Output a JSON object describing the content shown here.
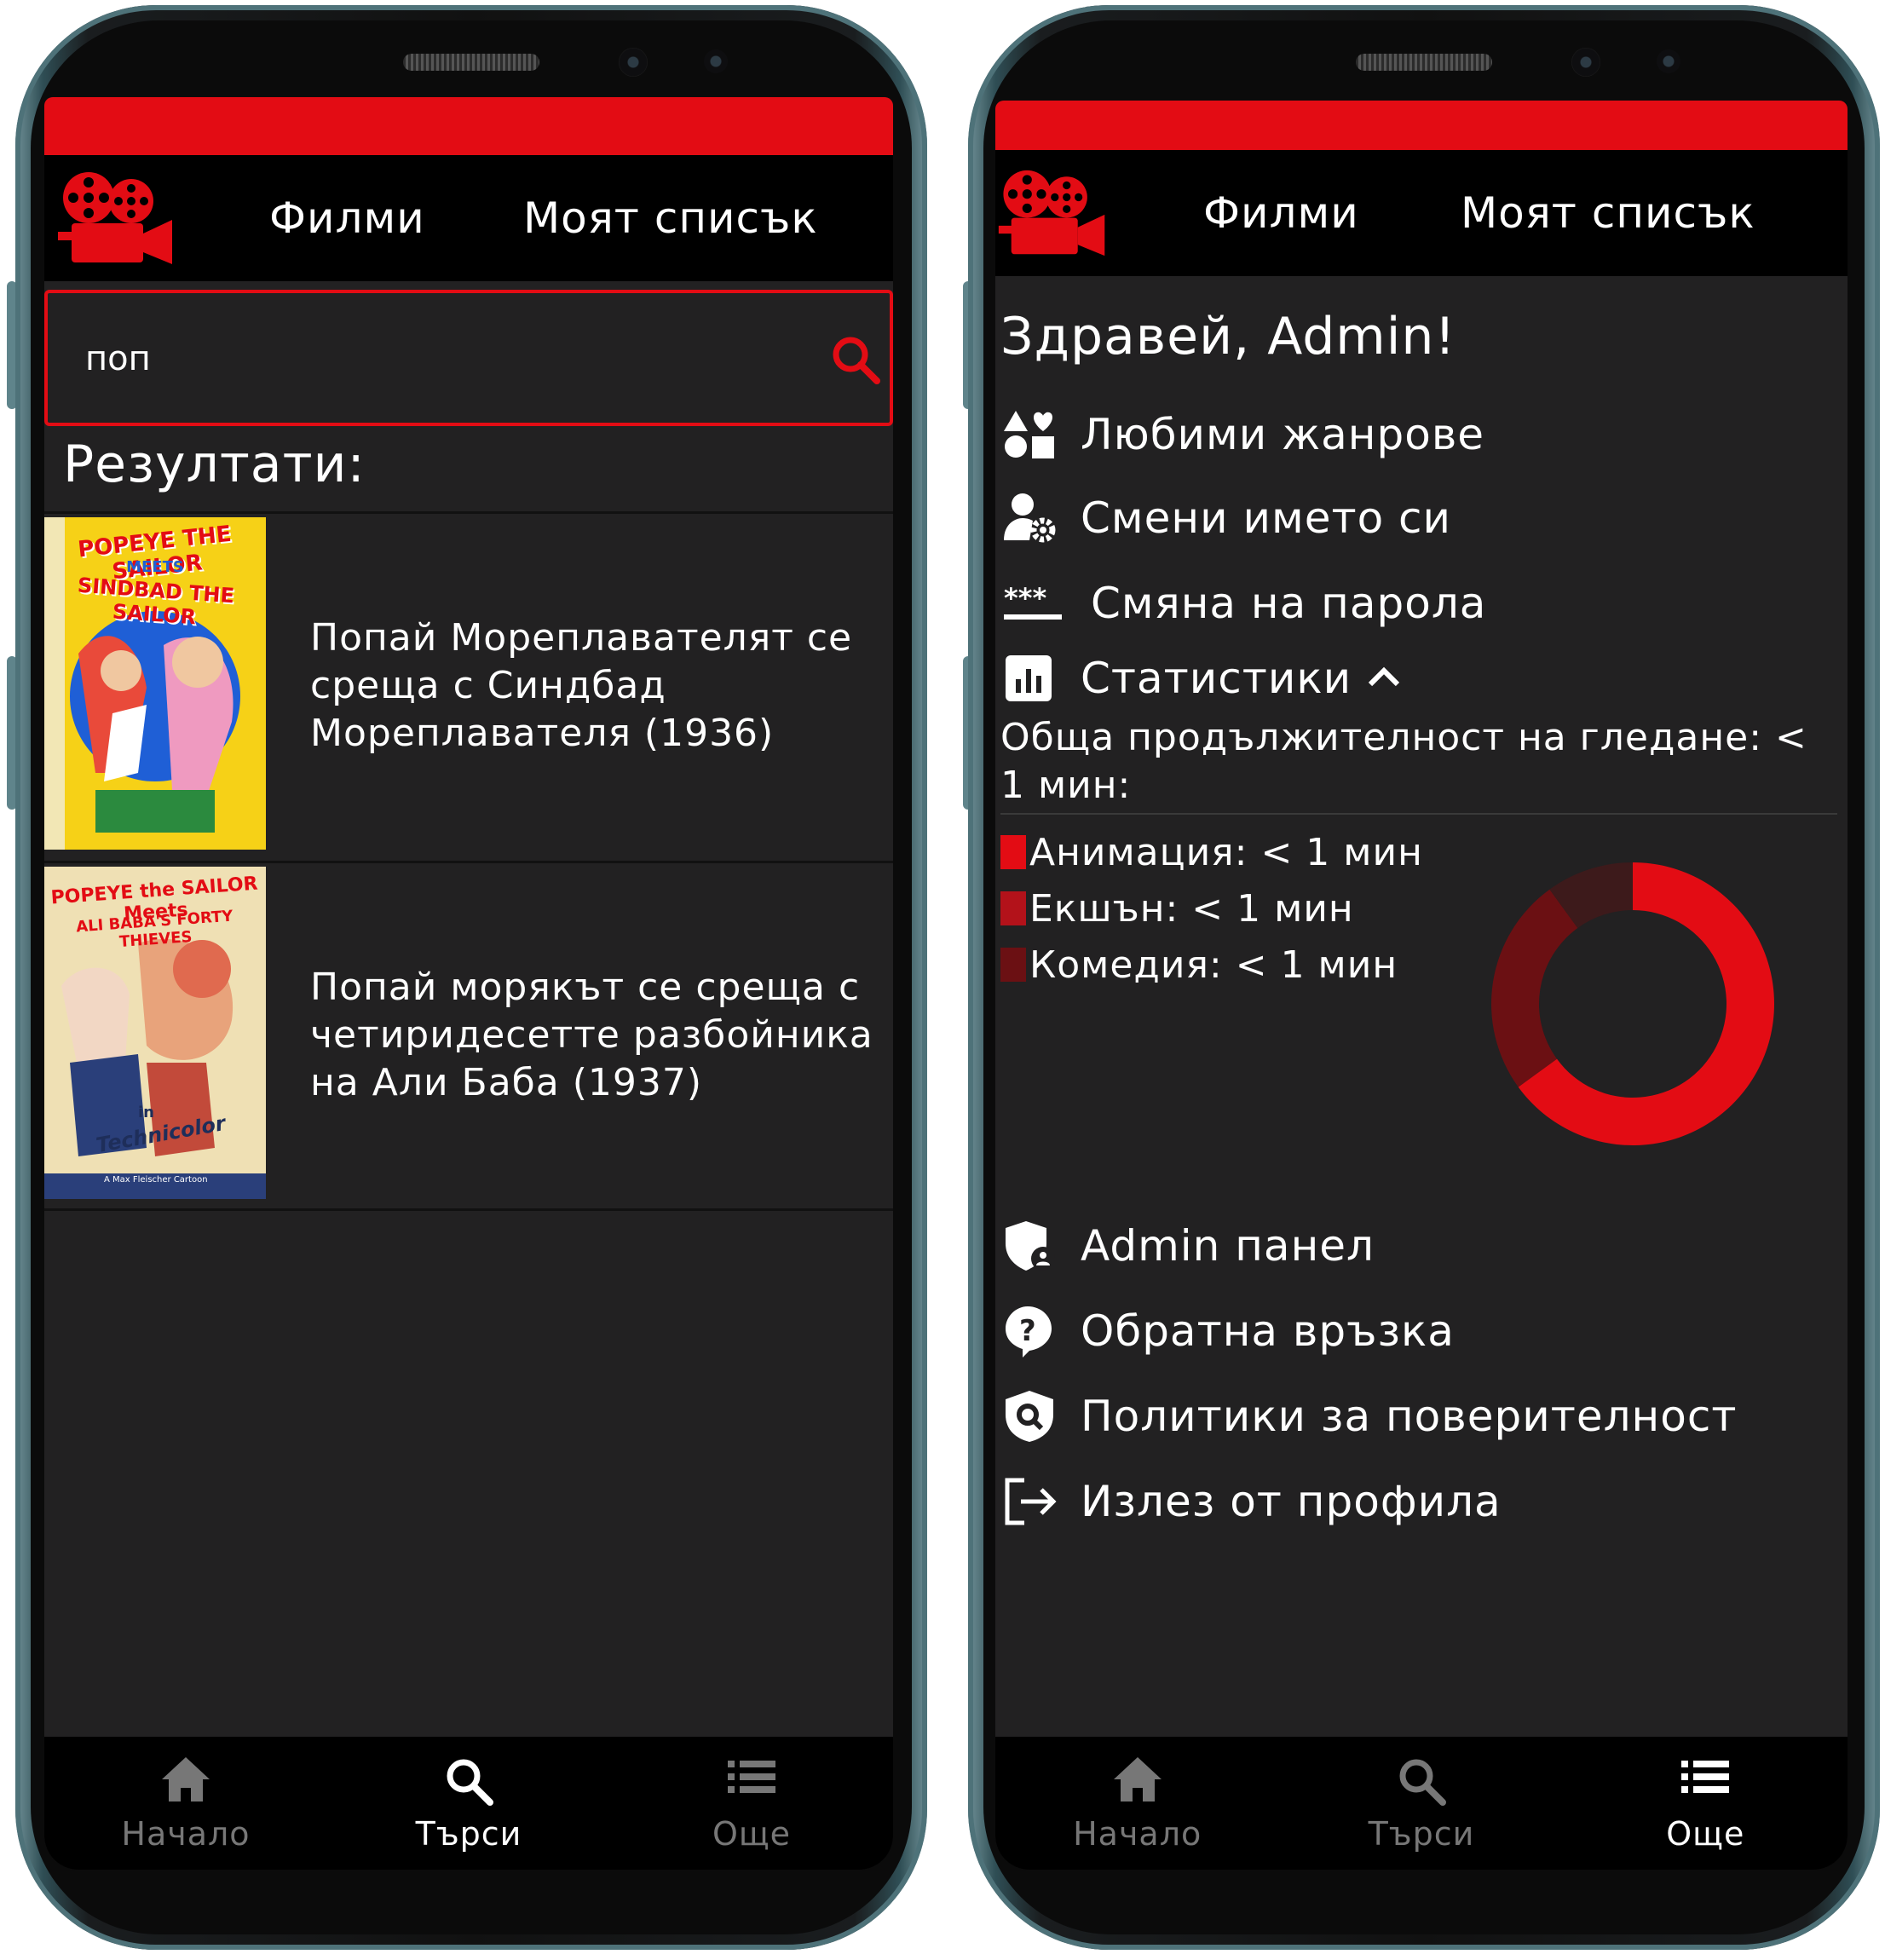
{
  "colors": {
    "accent": "#e30c14",
    "dark_red": "#b3121a",
    "maroon": "#6b1013",
    "screen_bg": "#222122",
    "header_bg": "#000000"
  },
  "left_screen": {
    "header": {
      "nav_films": "Филми",
      "nav_my_list": "Моят списък"
    },
    "search": {
      "value": "поп",
      "icon": "search-icon"
    },
    "results_title": "Резултати:",
    "results": [
      {
        "title": "Попай Мореплавателят се среща с Синдбад Мореплавателя (1936)",
        "poster_lines": [
          "POPEYE THE SAILOR",
          "MEETS",
          "SINDBAD THE SAILOR"
        ]
      },
      {
        "title": "Попай морякът се среща с четиридесетте разбойника на Али Баба (1937)",
        "poster_lines": [
          "POPEYE the SAILOR Meets",
          "ALI BABA'S FORTY THIEVES",
          "in",
          "Technicolor",
          "A Max Fleischer Cartoon"
        ]
      }
    ],
    "bottom_nav": [
      {
        "label": "Начало",
        "icon": "home-icon",
        "active": false
      },
      {
        "label": "Търси",
        "icon": "search-icon",
        "active": true
      },
      {
        "label": "Още",
        "icon": "list-icon",
        "active": false
      }
    ]
  },
  "right_screen": {
    "header": {
      "nav_films": "Филми",
      "nav_my_list": "Моят списък"
    },
    "greeting": "Здравей, Admin!",
    "menu": {
      "favorite_genres": "Любими жанрове",
      "change_name": "Смени името си",
      "change_password": "Смяна на парола",
      "statistics": "Статистики",
      "admin_panel": "Admin панел",
      "feedback": "Обратна връзка",
      "privacy": "Политики за поверителност",
      "logout": "Излез от профила"
    },
    "stats": {
      "total_watch_time": "Обща продължителност на гледане: < 1 мин:",
      "legend": [
        {
          "label": "Анимация: < 1 мин",
          "color": "#e30c14"
        },
        {
          "label": "Екшън: < 1 мин",
          "color": "#b3121a"
        },
        {
          "label": "Комедия: < 1 мин",
          "color": "#6b1013"
        }
      ]
    },
    "bottom_nav": [
      {
        "label": "Начало",
        "icon": "home-icon",
        "active": false
      },
      {
        "label": "Търси",
        "icon": "search-icon",
        "active": false
      },
      {
        "label": "Още",
        "icon": "list-icon",
        "active": true
      }
    ]
  },
  "chart_data": {
    "type": "pie",
    "categories": [
      "Анимация",
      "Екшън",
      "Комедия"
    ],
    "values": [
      65,
      25,
      10
    ],
    "colors": [
      "#e30c14",
      "#6b1013",
      "#3d1a1b"
    ],
    "donut": true,
    "title": "",
    "xlabel": "",
    "ylabel": ""
  }
}
